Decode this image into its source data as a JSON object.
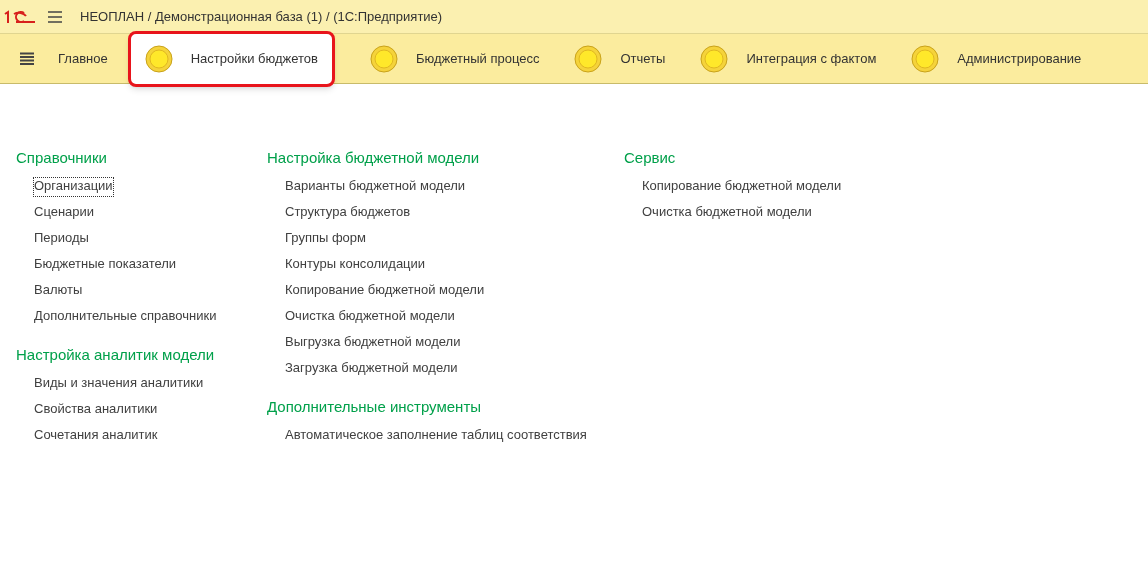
{
  "window": {
    "title": "НЕОПЛАН / Демонстрационная база (1) /  (1С:Предприятие)"
  },
  "sections": [
    {
      "label": "Главное",
      "kind": "home",
      "selected": false
    },
    {
      "label": "Настройки бюджетов",
      "kind": "section",
      "selected": true
    },
    {
      "label": "Бюджетный процесс",
      "kind": "section",
      "selected": false
    },
    {
      "label": "Отчеты",
      "kind": "section",
      "selected": false
    },
    {
      "label": "Интеграция с фактом",
      "kind": "section",
      "selected": false
    },
    {
      "label": "Администрирование",
      "kind": "section",
      "selected": false
    }
  ],
  "columns": [
    {
      "groups": [
        {
          "title": "Справочники",
          "items": [
            {
              "label": "Организации",
              "focused": true
            },
            {
              "label": "Сценарии",
              "focused": false
            },
            {
              "label": "Периоды",
              "focused": false
            },
            {
              "label": "Бюджетные показатели",
              "focused": false
            },
            {
              "label": "Валюты",
              "focused": false
            },
            {
              "label": "Дополнительные справочники",
              "focused": false
            }
          ]
        },
        {
          "title": "Настройка аналитик модели",
          "items": [
            {
              "label": "Виды и значения аналитики",
              "focused": false
            },
            {
              "label": "Свойства аналитики",
              "focused": false
            },
            {
              "label": "Сочетания аналитик",
              "focused": false
            }
          ]
        }
      ]
    },
    {
      "groups": [
        {
          "title": "Настройка бюджетной модели",
          "items": [
            {
              "label": "Варианты бюджетной модели",
              "focused": false
            },
            {
              "label": "Структура бюджетов",
              "focused": false
            },
            {
              "label": "Группы форм",
              "focused": false
            },
            {
              "label": "Контуры консолидации",
              "focused": false
            },
            {
              "label": "Копирование бюджетной модели",
              "focused": false
            },
            {
              "label": "Очистка бюджетной модели",
              "focused": false
            },
            {
              "label": "Выгрузка бюджетной модели",
              "focused": false
            },
            {
              "label": "Загрузка бюджетной модели",
              "focused": false
            }
          ]
        },
        {
          "title": "Дополнительные инструменты",
          "items": [
            {
              "label": "Автоматическое заполнение таблиц соответствия",
              "focused": false
            }
          ]
        }
      ]
    },
    {
      "groups": [
        {
          "title": "Сервис",
          "items": [
            {
              "label": "Копирование бюджетной модели",
              "focused": false
            },
            {
              "label": "Очистка бюджетной модели",
              "focused": false
            }
          ]
        }
      ]
    }
  ]
}
